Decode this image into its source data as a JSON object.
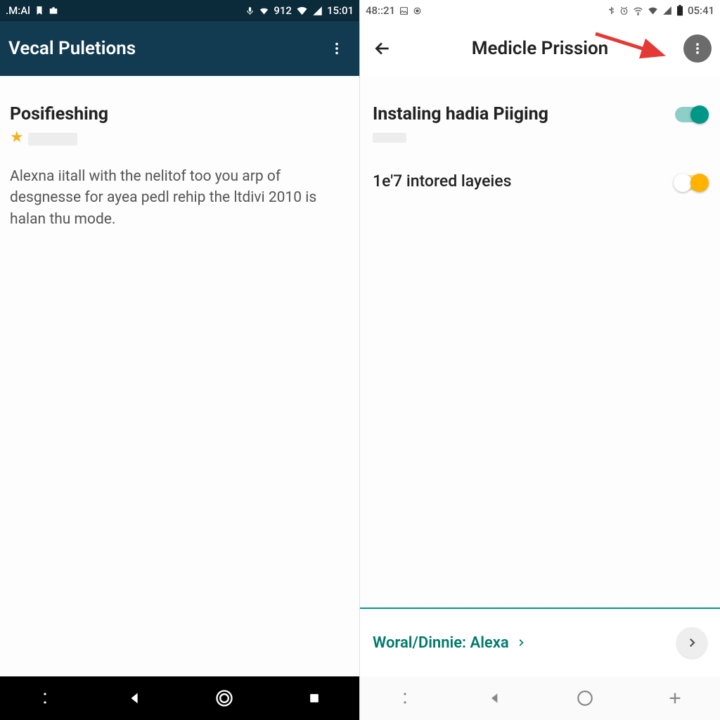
{
  "left": {
    "status": {
      "left_text": ".M:Al",
      "signal": "912",
      "time": "15:01"
    },
    "appbar": {
      "title": "Vecal Puletions"
    },
    "section": {
      "title": "Posifieshing",
      "body": "Alexna iitall with the nelitof too you arp of desgnesse for ayea pedl rehip the ltdivi 2010 is halan thu mode."
    }
  },
  "right": {
    "status": {
      "left_text": "48::21",
      "time": "05:41"
    },
    "appbar": {
      "title": "Medicle Prission"
    },
    "settings": {
      "row1_label": "Instaling hadia Piiging",
      "row2_label": "1e'7 intored layeies"
    },
    "bottom": {
      "label": "Woral/Dinnie: Alexa"
    }
  },
  "icons": {
    "more": "more-vert-icon",
    "back": "arrow-back-icon",
    "star": "star-icon"
  },
  "colors": {
    "teal": "#009688",
    "amber": "#ffb300",
    "appbar_dark": "#123a50"
  }
}
